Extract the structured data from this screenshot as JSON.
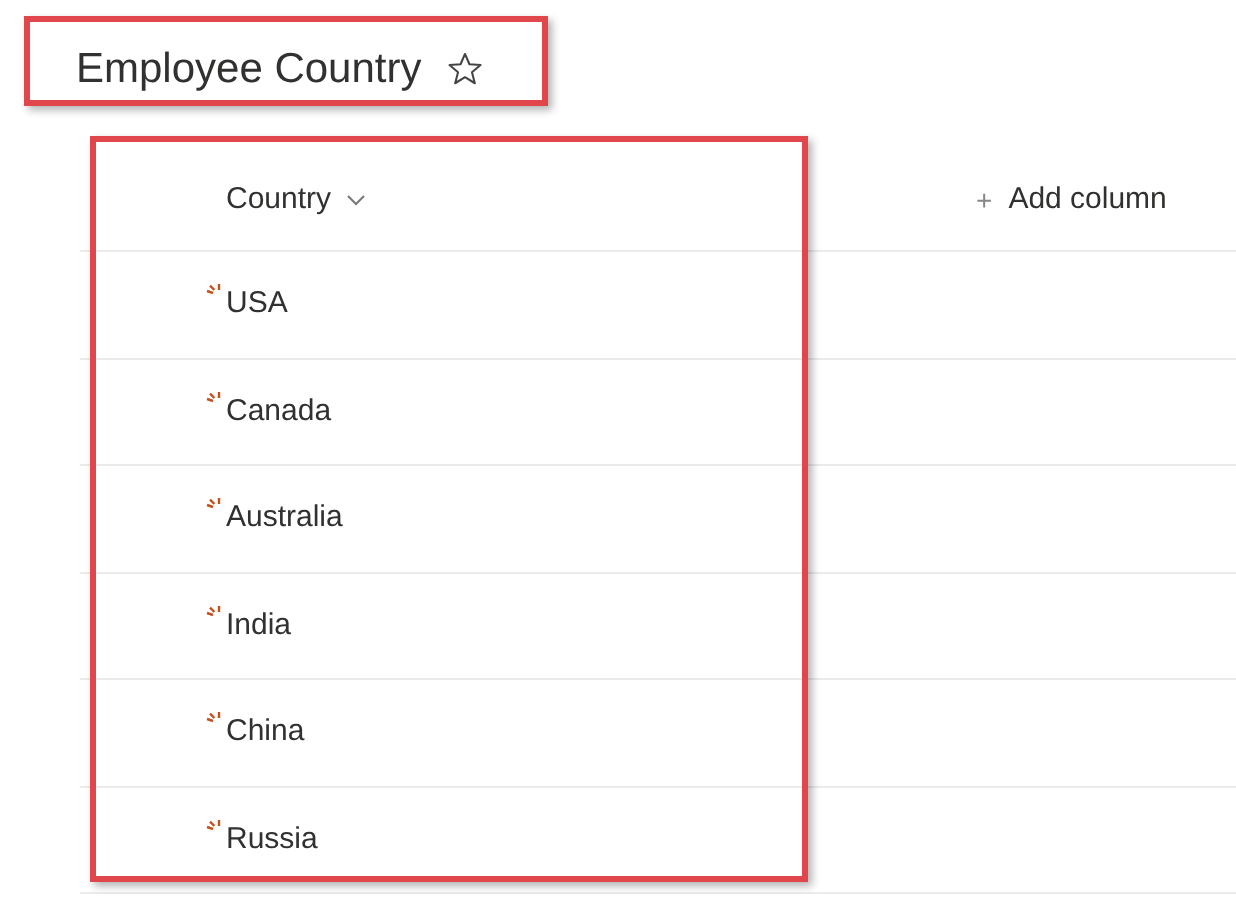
{
  "list": {
    "title": "Employee Country",
    "favorite": false
  },
  "table": {
    "columns": [
      {
        "label": "Country",
        "kind": "sortable"
      }
    ],
    "add_column": {
      "icon": "+",
      "label": "Add column"
    },
    "rows": [
      {
        "country": "USA",
        "is_new": true
      },
      {
        "country": "Canada",
        "is_new": true
      },
      {
        "country": "Australia",
        "is_new": true
      },
      {
        "country": "India",
        "is_new": true
      },
      {
        "country": "China",
        "is_new": true
      },
      {
        "country": "Russia",
        "is_new": true
      }
    ]
  }
}
